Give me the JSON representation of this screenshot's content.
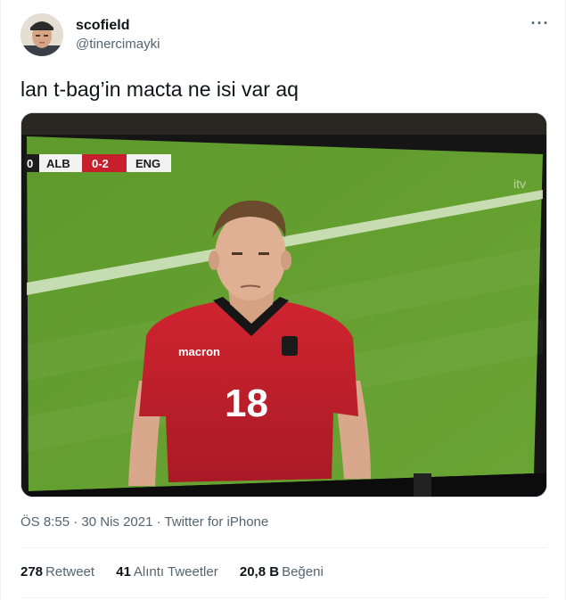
{
  "tweet": {
    "author": {
      "display_name": "scofield",
      "handle": "@tinercimayki",
      "avatar": "profile-photo"
    },
    "more_icon": "more-horizontal-icon",
    "text": "lan t-bag’in macta ne isi var aq",
    "media": {
      "description": "photo",
      "scoreboard": {
        "left_fragment": "0",
        "team_home": "ALB",
        "score": "0-2",
        "team_away": "ENG"
      },
      "jersey": {
        "brand": "macron",
        "number": "18"
      },
      "channel_logo": "itv",
      "colors": {
        "pitch": "#5f9a2f",
        "shirt": "#c7202c"
      }
    },
    "meta": {
      "time": "ÖS 8:55",
      "separator": " · ",
      "date": "30 Nis 2021",
      "source": "Twitter for iPhone"
    },
    "stats": [
      {
        "count": "278",
        "label": "Retweet"
      },
      {
        "count": "41",
        "label": "Alıntı Tweetler"
      },
      {
        "count": "20,8 B",
        "label": "Beğeni"
      }
    ]
  }
}
